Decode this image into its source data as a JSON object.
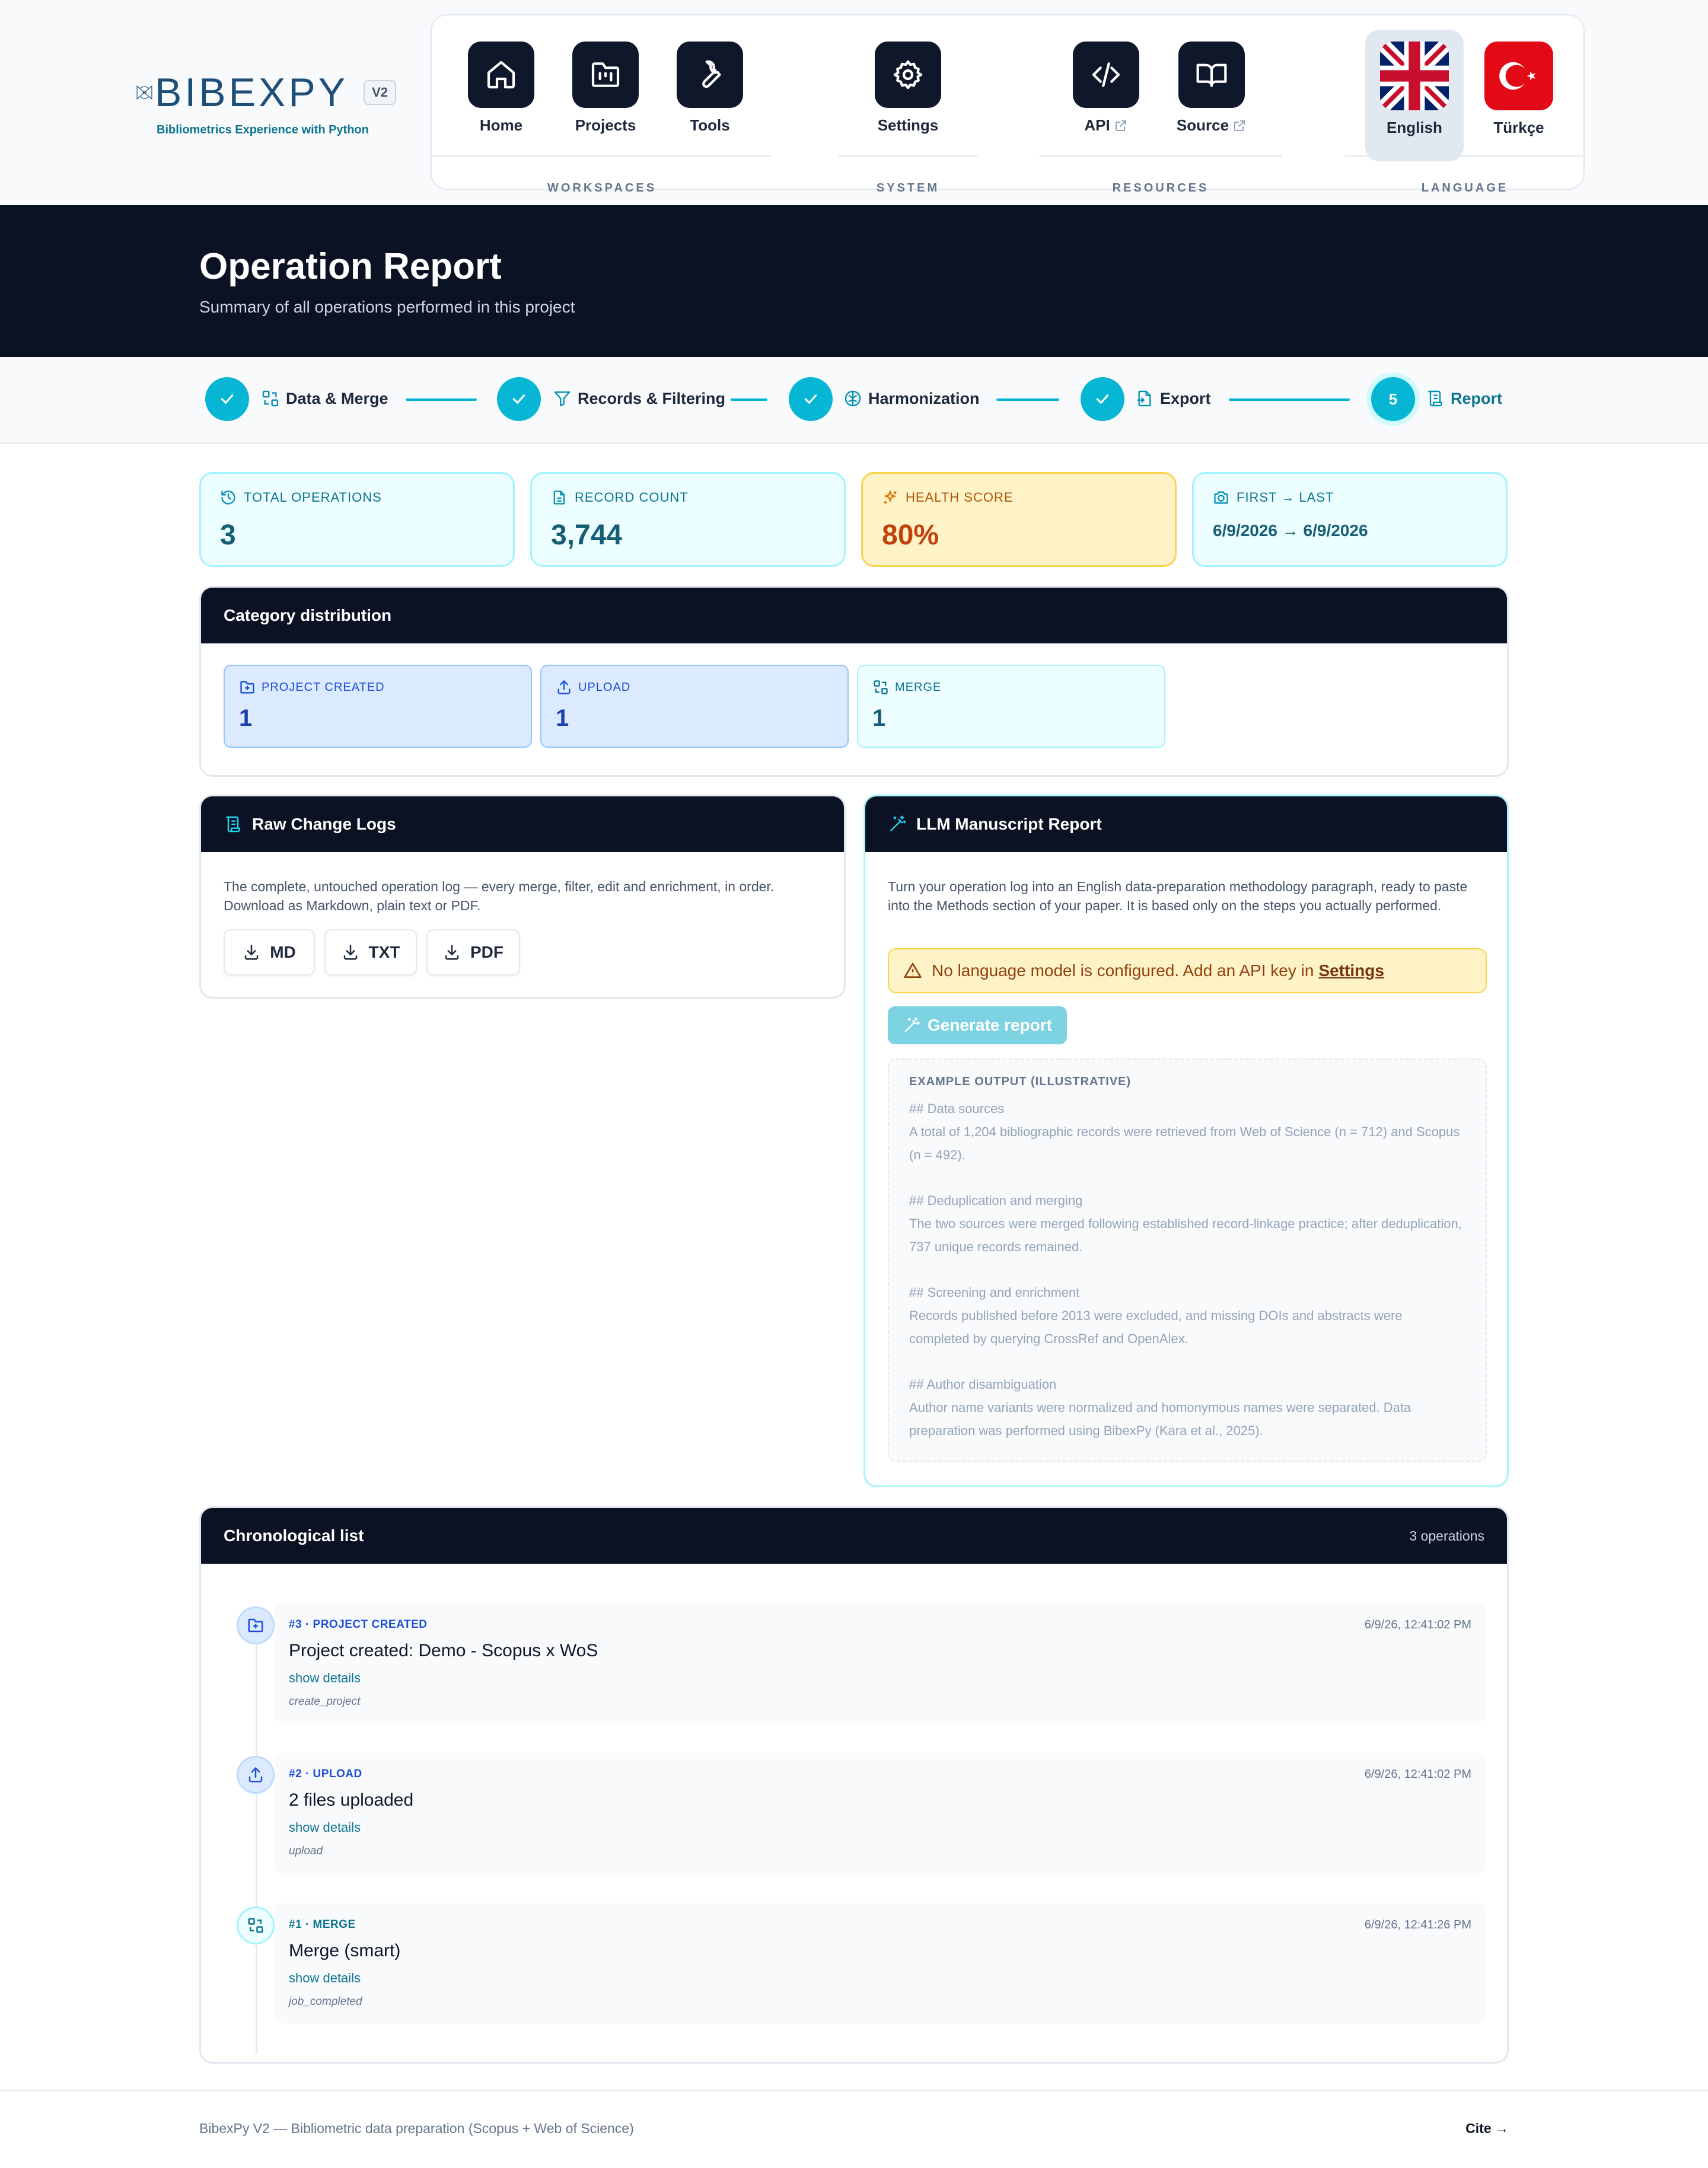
{
  "brand": {
    "name": "BIBEXPY",
    "version": "V2",
    "tagline": "Bibliometrics Experience with Python"
  },
  "nav": {
    "workspaces": {
      "label": "WORKSPACES",
      "items": [
        "Home",
        "Projects",
        "Tools"
      ]
    },
    "system": {
      "label": "SYSTEM",
      "items": [
        "Settings"
      ]
    },
    "resources": {
      "label": "RESOURCES",
      "items": [
        "API",
        "Source"
      ]
    },
    "language": {
      "label": "LANGUAGE",
      "items": [
        "English",
        "Türkçe"
      ],
      "active": "English"
    }
  },
  "hero": {
    "title": "Operation Report",
    "subtitle": "Summary of all operations performed in this project"
  },
  "stepper": {
    "steps": [
      {
        "label": "Data & Merge",
        "status": "done"
      },
      {
        "label": "Records & Filtering",
        "status": "done"
      },
      {
        "label": "Harmonization",
        "status": "done"
      },
      {
        "label": "Export",
        "status": "done"
      },
      {
        "label": "Report",
        "status": "current",
        "number": "5"
      }
    ]
  },
  "stats": [
    {
      "label": "TOTAL OPERATIONS",
      "value": "3"
    },
    {
      "label": "RECORD COUNT",
      "value": "3,744"
    },
    {
      "label": "HEALTH SCORE",
      "value": "80%"
    },
    {
      "label": "FIRST → LAST",
      "value": "6/9/2026 → 6/9/2026"
    }
  ],
  "category": {
    "title": "Category distribution",
    "items": [
      {
        "label": "PROJECT CREATED",
        "value": "1"
      },
      {
        "label": "UPLOAD",
        "value": "1"
      },
      {
        "label": "MERGE",
        "value": "1"
      }
    ]
  },
  "raw_logs": {
    "title": "Raw Change Logs",
    "description": "The complete, untouched operation log — every merge, filter, edit and enrichment, in order. Download as Markdown, plain text or PDF.",
    "buttons": [
      "MD",
      "TXT",
      "PDF"
    ]
  },
  "llm": {
    "title": "LLM Manuscript Report",
    "description": "Turn your operation log into an English data-preparation methodology paragraph, ready to paste into the Methods section of your paper. It is based only on the steps you actually performed.",
    "warning": "No language model is configured. Add an API key in",
    "warning_link": "Settings",
    "generate_label": "Generate report",
    "example_label": "EXAMPLE OUTPUT (ILLUSTRATIVE)",
    "example": [
      {
        "heading": "## Data sources",
        "text": "A total of 1,204 bibliographic records were retrieved from Web of Science (n = 712) and Scopus (n = 492)."
      },
      {
        "heading": "## Deduplication and merging",
        "text": "The two sources were merged following established record-linkage practice; after deduplication, 737 unique records remained."
      },
      {
        "heading": "## Screening and enrichment",
        "text": "Records published before 2013 were excluded, and missing DOIs and abstracts were completed by querying CrossRef and OpenAlex."
      },
      {
        "heading": "## Author disambiguation",
        "text": "Author name variants were normalized and homonymous names were separated. Data preparation was performed using BibexPy (Kara et al., 2025)."
      }
    ]
  },
  "chronological": {
    "title": "Chronological list",
    "count_label": "3 operations",
    "show_details": "show details",
    "items": [
      {
        "meta": "#3 · PROJECT CREATED",
        "time": "6/9/26, 12:41:02 PM",
        "title": "Project created: Demo - Scopus x WoS",
        "code": "create_project"
      },
      {
        "meta": "#2 · UPLOAD",
        "time": "6/9/26, 12:41:02 PM",
        "title": "2 files uploaded",
        "code": "upload"
      },
      {
        "meta": "#1 · MERGE",
        "time": "6/9/26, 12:41:26 PM",
        "title": "Merge (smart)",
        "code": "job_completed"
      }
    ]
  },
  "footer": {
    "left": "BibexPy V2 — Bibliometric data preparation (Scopus + Web of Science)",
    "right": "Cite →"
  }
}
